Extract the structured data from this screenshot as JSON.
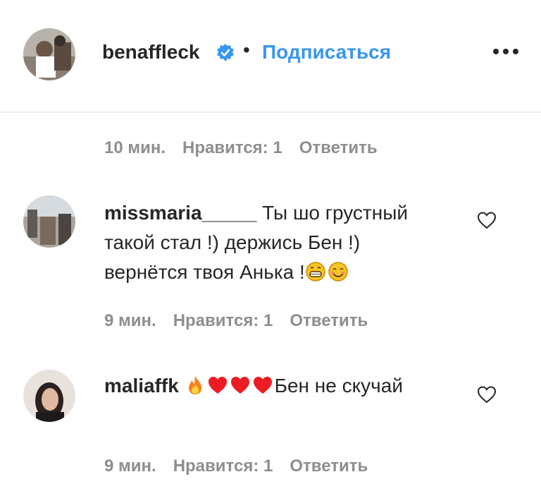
{
  "header": {
    "username": "benaffleck",
    "separator": "•",
    "follow_label": "Подписаться"
  },
  "first_meta": {
    "time": "10 мин.",
    "likes": "Нравится: 1",
    "reply": "Ответить"
  },
  "comments": [
    {
      "username": "missmaria_____",
      "text": " Ты шо грустный такой стал !) держись Бен !) вернётся твоя Анька !",
      "emojis": [
        "grinning-face",
        "smiling-face"
      ],
      "time": "9 мин.",
      "likes": "Нравится: 1",
      "reply": "Ответить"
    },
    {
      "username": "maliaffk",
      "emojis": [
        "fire",
        "red-heart",
        "red-heart",
        "red-heart"
      ],
      "text": "Бен не скучай",
      "time": "9 мин.",
      "likes": "Нравится: 1",
      "reply": "Ответить"
    }
  ],
  "colors": {
    "link_blue": "#3897f0",
    "meta_gray": "#8e8e8e",
    "text": "#262626",
    "heart_red": "#ed1c24"
  }
}
